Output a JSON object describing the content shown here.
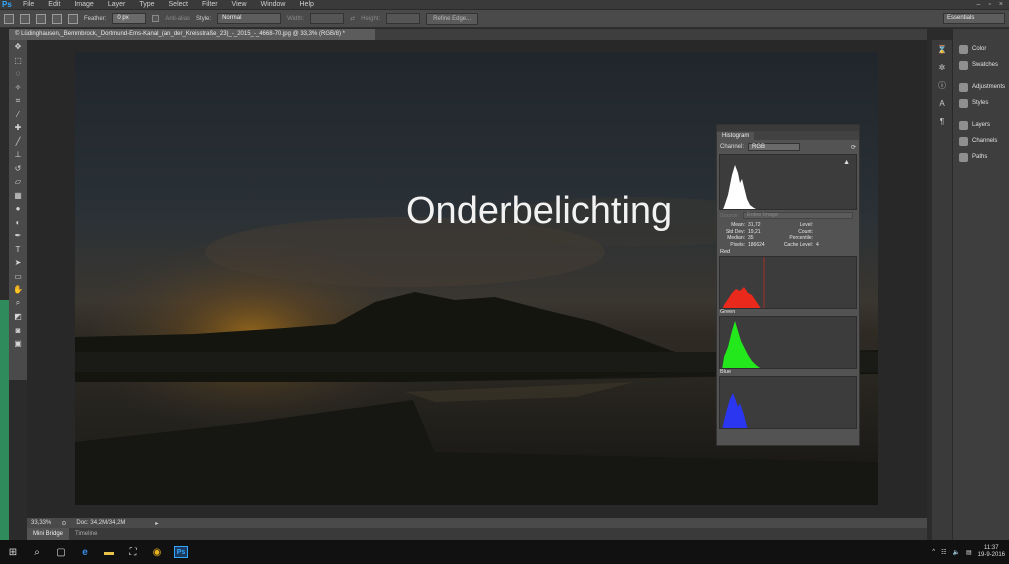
{
  "app": {
    "name": "Ps"
  },
  "menu": [
    "File",
    "Edit",
    "Image",
    "Layer",
    "Type",
    "Select",
    "Filter",
    "View",
    "Window",
    "Help"
  ],
  "options_bar": {
    "feather_label": "Feather:",
    "feather_value": "0 px",
    "anti_alias_label": "Anti-alias",
    "style_label": "Style:",
    "style_value": "Normal",
    "width_label": "Width:",
    "height_label": "Height:",
    "refine_button": "Refine Edge...",
    "workspace": "Essentials"
  },
  "document": {
    "tab_title": "© Lüdinghausen,_Bemmbrock,_Dortmund-Ems-Kanal_(an_der_Kreisstraße_23)_-_2015_-_4668-70.jpg @ 33,3% (RGB/8) *",
    "overlay_text": "Onderbelichting"
  },
  "status_bar": {
    "zoom": "33,33%",
    "doc_info": "Doc: 34,2M/34,2M"
  },
  "bottom_tabs": [
    "Mini Bridge",
    "Timeline"
  ],
  "right_panel": {
    "groups": [
      [
        "Color",
        "Swatches"
      ],
      [
        "Adjustments",
        "Styles"
      ],
      [
        "Layers",
        "Channels",
        "Paths"
      ]
    ]
  },
  "histogram": {
    "tab": "Histogram",
    "channel_label": "Channel:",
    "channel_value": "RGB",
    "source_label": "Source:",
    "source_value": "Entire Image",
    "stats": {
      "mean_label": "Mean:",
      "mean": "31,72",
      "stddev_label": "Std Dev:",
      "stddev": "19,21",
      "median_label": "Median:",
      "median": "35",
      "pixels_label": "Pixels:",
      "pixels": "186624",
      "level_label": "Level:",
      "level": "",
      "count_label": "Count:",
      "count": "",
      "percentile_label": "Percentile:",
      "percentile": "",
      "cache_label": "Cache Level:",
      "cache": "4"
    },
    "channels": [
      {
        "label": "Red",
        "color": "#e8291c"
      },
      {
        "label": "Green",
        "color": "#22e81c"
      },
      {
        "label": "Blue",
        "color": "#2a36f0"
      }
    ]
  },
  "taskbar": {
    "time": "11:37",
    "date": "19-9-2016"
  }
}
